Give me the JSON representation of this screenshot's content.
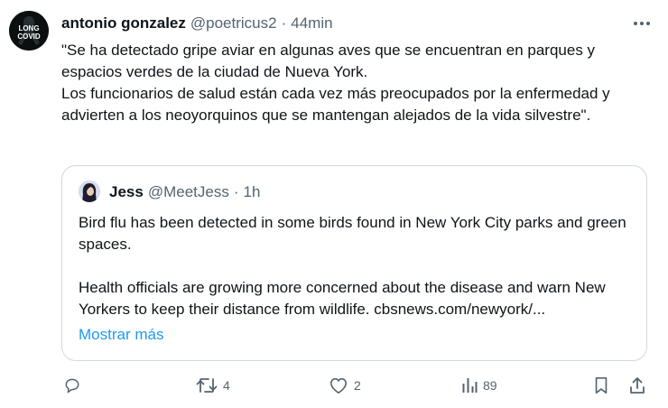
{
  "tweet": {
    "author_name": "antonio gonzalez",
    "author_handle": "@poetricus2",
    "separator": "·",
    "time": "44min",
    "avatar_text_top": "LONG",
    "avatar_text_bottom": "COVID",
    "text": [
      "\"Se ha detectado gripe aviar en algunas aves que se encuentran en parques y espacios verdes de la ciudad de Nueva York.",
      "Los funcionarios de salud están cada vez más preocupados por la enfermedad y advierten a los neoyorquinos que se mantengan alejados de la vida silvestre\"."
    ]
  },
  "quote": {
    "author_name": "Jess",
    "author_handle": "@MeetJess",
    "separator": "·",
    "time": "1h",
    "text": [
      "Bird flu has been detected in some birds found in New York City parks and green spaces.",
      "Health officials are growing more concerned about the disease and warn New Yorkers to keep their distance from wildlife. cbsnews.com/newyork/..."
    ],
    "show_more": "Mostrar más"
  },
  "actions": {
    "reply_count": "",
    "retweet_count": "4",
    "like_count": "2",
    "views_count": "89"
  },
  "icons": {
    "more": "more-icon",
    "reply": "reply-icon",
    "retweet": "retweet-icon",
    "like": "heart-icon",
    "views": "views-icon",
    "bookmark": "bookmark-icon",
    "share": "share-icon"
  },
  "colors": {
    "text": "#0f1419",
    "secondary": "#536471",
    "link": "#1d9bf0",
    "border": "#cfd9de"
  }
}
